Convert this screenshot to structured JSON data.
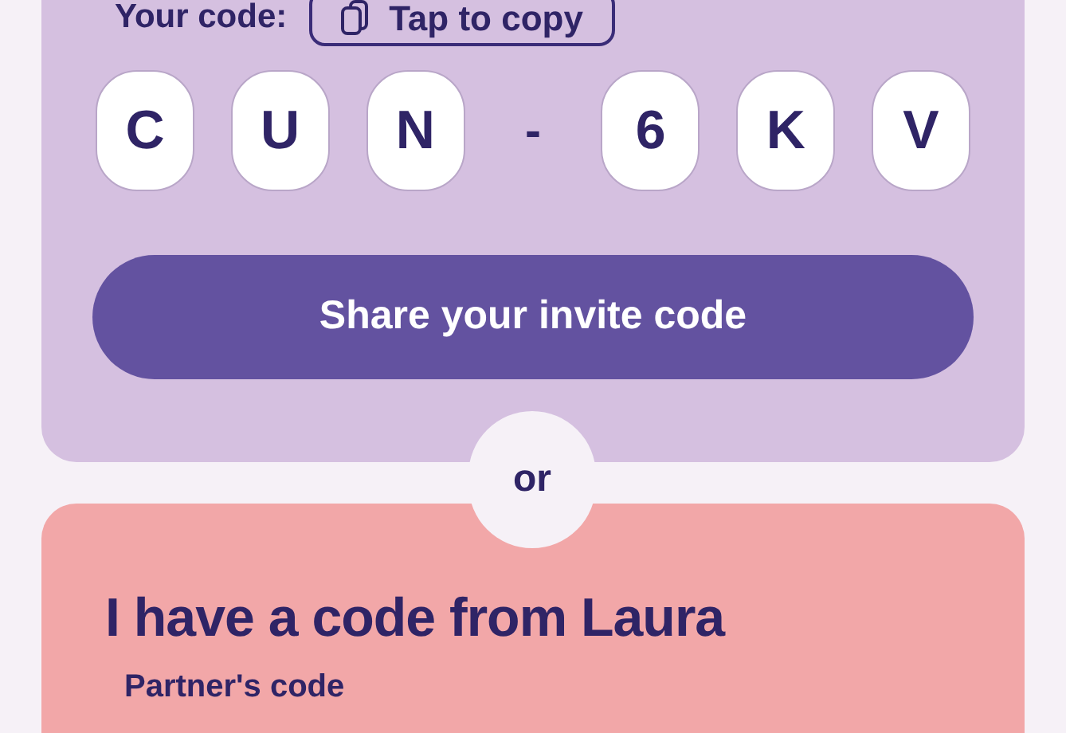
{
  "invite_card": {
    "code_label": "Your code:",
    "copy_button": "Tap to copy",
    "code_characters": [
      {
        "kind": "tile",
        "text": "C"
      },
      {
        "kind": "tile",
        "text": "U"
      },
      {
        "kind": "tile",
        "text": "N"
      },
      {
        "kind": "separator",
        "text": "-"
      },
      {
        "kind": "tile",
        "text": "6"
      },
      {
        "kind": "tile",
        "text": "K"
      },
      {
        "kind": "tile",
        "text": "V"
      }
    ],
    "share_button": "Share your invite code"
  },
  "divider_label": "or",
  "partner_card": {
    "heading": "I have a code from Laura",
    "field_label": "Partner's code"
  }
}
